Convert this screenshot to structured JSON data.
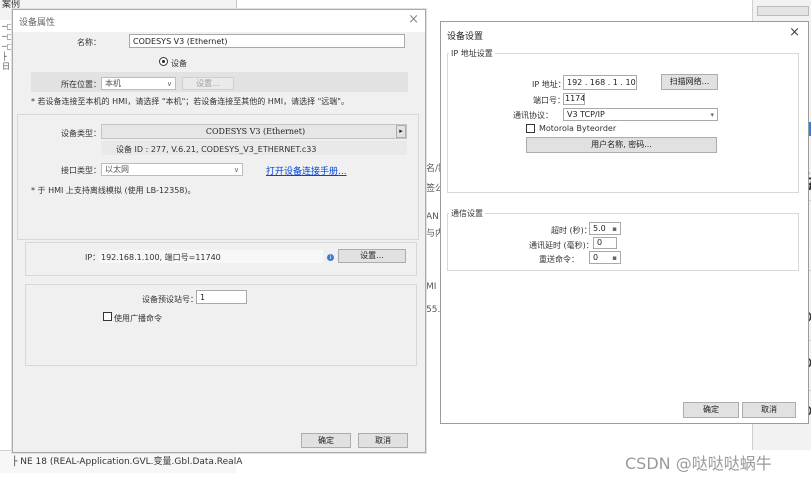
{
  "background": {
    "top_text": "案例",
    "tree_markers": [
      "─□",
      "─□",
      "─□",
      "├日"
    ],
    "bottom_text": "├ NE 18 (REAL-Application.GVL.变量.Gbl.Data.RealA",
    "mid_fragments": [
      "名/雛",
      "签公",
      "AN",
      "与内",
      "MI",
      "55."
    ],
    "right_hash": [
      "#",
      "#"
    ],
    "right_partial": [
      "D",
      "D",
      "D"
    ]
  },
  "watermark": "CSDN @哒哒哒蜗牛",
  "left_dialog": {
    "title": "设备属性",
    "close_label": "×",
    "name_label": "名称：",
    "name_value": "CODESYS V3 (Ethernet)",
    "radio_device_label": "设备",
    "location_label": "所在位置：",
    "location_value": "本机",
    "location_settings_button": "设置...",
    "location_note": "* 若设备连接至本机的 HMI，请选择 \"本机\"；若设备连接至其他的 HMI，请选择 \"远端\"。",
    "device_type_label": "设备类型：",
    "device_type_value": "CODESYS V3 (Ethernet)",
    "device_type_arrow": "▸",
    "device_info": "设备 ID : 277, V.6.21, CODESYS_V3_ETHERNET.c33",
    "interface_label": "接口类型：",
    "interface_value": "以太网",
    "manual_link": "打开设备连接手册...",
    "offline_note": "* 于 HMI 上支持离线模拟 (使用 LB-12358)。",
    "ip_label": "IP：",
    "ip_value": "192.168.1.100,  端口号=11740",
    "ip_settings_button": "设置...",
    "station_label": "设备预设站号：",
    "station_value": "1",
    "broadcast_label": "使用广播命令",
    "ok_button": "确定",
    "cancel_button": "取消"
  },
  "right_dialog": {
    "title": "设备设置",
    "close_label": "×",
    "ip_group_legend": "IP 地址设置",
    "ip_address_label": "IP 地址：",
    "ip_address_value": "192 . 168 .  1  . 100",
    "scan_button": "扫描网络...",
    "port_label": "端口号：",
    "port_value": "11740",
    "protocol_label": "通讯协议：",
    "protocol_value": "V3 TCP/IP",
    "motorola_label": "Motorola Byteorder",
    "user_pass_button": "用户名称, 密码...",
    "comm_group_legend": "通信设置",
    "timeout_label": "超时 (秒)：",
    "timeout_value": "5.0",
    "delay_label": "通讯延时 (毫秒)：",
    "delay_value": "0",
    "retry_label": "重送命令：",
    "retry_value": "0",
    "ok_button": "确定",
    "cancel_button": "取消"
  }
}
